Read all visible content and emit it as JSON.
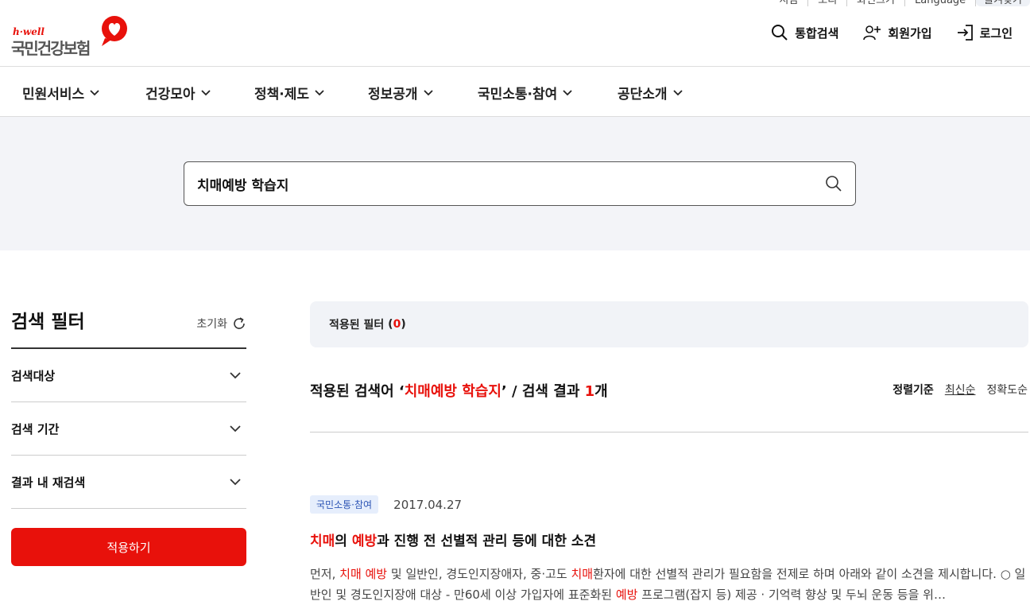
{
  "util_bar": [
    "지점",
    "소리",
    "화면크기",
    "Language",
    "즐겨찾기"
  ],
  "logo": {
    "brand_en": "h·well",
    "brand_kr": "국민건강보험"
  },
  "header_actions": {
    "search": "통합검색",
    "signup": "회원가입",
    "login": "로그인"
  },
  "gnb": [
    "민원서비스",
    "건강모아",
    "정책·제도",
    "정보공개",
    "국민소통·참여",
    "공단소개"
  ],
  "search": {
    "query": "치매예방 학습지"
  },
  "filter": {
    "title": "검색 필터",
    "reset": "초기화",
    "sections": [
      "검색대상",
      "검색 기간",
      "결과 내 재검색"
    ],
    "apply": "적용하기"
  },
  "applied_filter": {
    "label": "적용된 필터",
    "count": "0"
  },
  "summary": {
    "prefix": "적용된 검색어 ‘",
    "term": "치매예방 학습지",
    "middle": "’ / 검색 결과 ",
    "count": "1",
    "suffix": "개"
  },
  "sort": {
    "label": "정렬기준",
    "options": [
      "최신순",
      "정확도순"
    ],
    "active": "최신순"
  },
  "results": [
    {
      "category": "국민소통·참여",
      "date": "2017.04.27",
      "title_parts": [
        {
          "t": "치매",
          "hl": true
        },
        {
          "t": "의 ",
          "hl": false
        },
        {
          "t": "예방",
          "hl": true
        },
        {
          "t": "과 진행 전 선별적 관리 등에 대한 소견",
          "hl": false
        }
      ],
      "body_parts": [
        {
          "t": "먼저, ",
          "hl": false
        },
        {
          "t": "치매 예방",
          "hl": true
        },
        {
          "t": " 및 일반인, 경도인지장애자, 중·고도 ",
          "hl": false
        },
        {
          "t": "치매",
          "hl": true
        },
        {
          "t": "환자에 대한 선별적 관리가 필요함을 전제로 하며 아래와 같이 소견을 제시합니다. ○ 일반인 및 경도인지장애 대상 - 만60세 이상 가입자에 표준화된 ",
          "hl": false
        },
        {
          "t": "예방",
          "hl": true
        },
        {
          "t": " 프로그램(잡지 등) 제공 · 기억력 향상 및 두뇌 운동 등을 위…",
          "hl": false
        }
      ]
    }
  ],
  "colors": {
    "accent": "#e8110b",
    "band": "#f3f4f8",
    "tag_bg": "#e6eefc",
    "tag_fg": "#2d55b5"
  }
}
